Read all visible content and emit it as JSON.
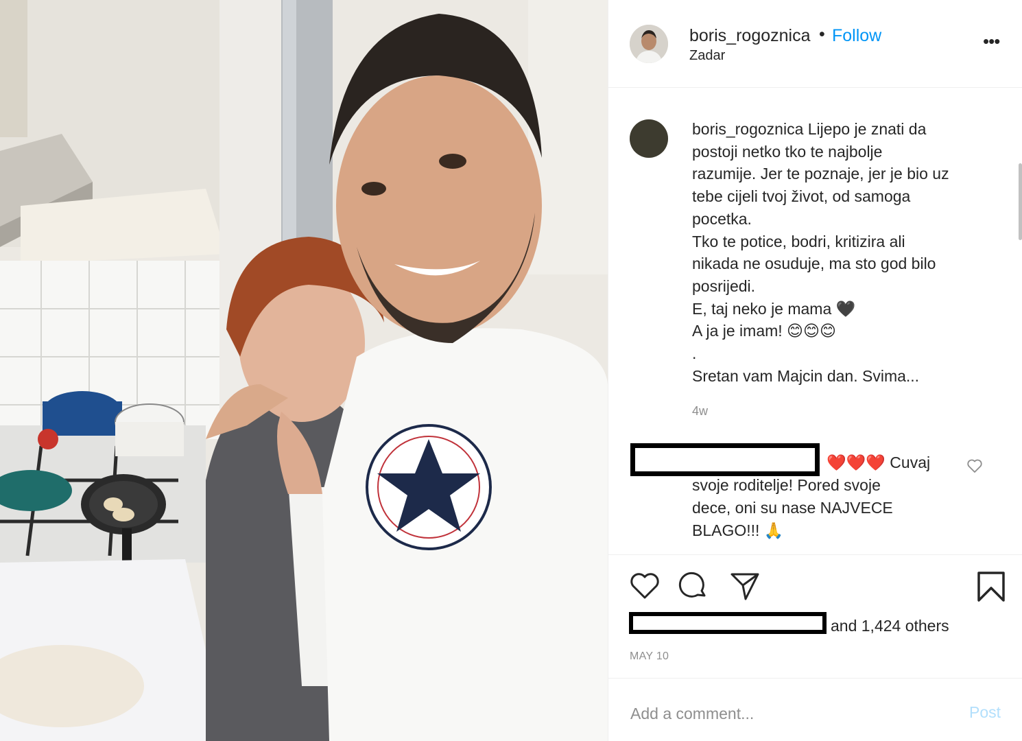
{
  "post": {
    "username": "boris_rogoznica",
    "dot": "•",
    "follow_label": "Follow",
    "location": "Zadar",
    "more_label": "•••"
  },
  "caption": {
    "username": "boris_rogoznica",
    "lines": [
      "Lijepo je znati da",
      "postoji netko tko te najbolje",
      "razumije. Jer te poznaje, jer je bio uz",
      "tebe cijeli tvoj život, od samoga",
      "pocetka.",
      "Tko te potice, bodri, kritizira ali",
      "nikada ne osuduje, ma sto god bilo",
      "posrijedi.",
      "E, taj neko je mama 🖤",
      "A ja je imam! 😊😊😊",
      ".",
      "Sretan vam Majcin dan. Svima..."
    ],
    "time": "4w"
  },
  "comment": {
    "lines": [
      "❤️❤️❤️ Cuvaj",
      "svoje roditelje! Pored svoje",
      "dece, oni su nase NAJVECE",
      "BLAGO!!! 🙏"
    ]
  },
  "likes": {
    "text": "and 1,424 others"
  },
  "date": "MAY 10",
  "add_comment": {
    "placeholder": "Add a comment...",
    "post_label": "Post"
  }
}
